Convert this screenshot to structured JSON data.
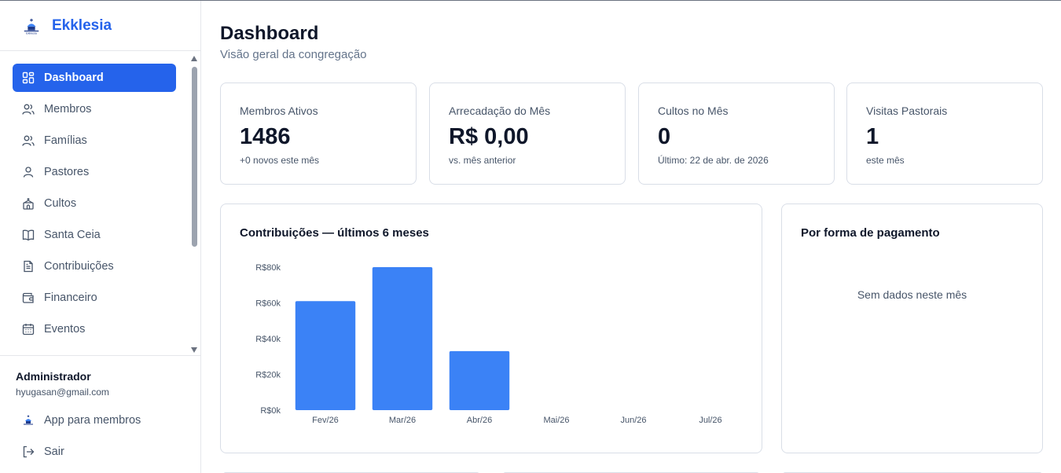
{
  "brand": {
    "name": "Ekklesia",
    "logo_text": "Ekklesia"
  },
  "sidebar": {
    "items": [
      {
        "label": "Dashboard",
        "icon": "grid-icon",
        "active": true
      },
      {
        "label": "Membros",
        "icon": "users-icon"
      },
      {
        "label": "Famílias",
        "icon": "family-icon"
      },
      {
        "label": "Pastores",
        "icon": "user-icon"
      },
      {
        "label": "Cultos",
        "icon": "church-icon"
      },
      {
        "label": "Santa Ceia",
        "icon": "book-icon"
      },
      {
        "label": "Contribuições",
        "icon": "file-text-icon"
      },
      {
        "label": "Financeiro",
        "icon": "wallet-icon"
      },
      {
        "label": "Eventos",
        "icon": "calendar-icon"
      }
    ]
  },
  "user": {
    "name": "Administrador",
    "email": "hyugasan@gmail.com",
    "app_label": "App para membros",
    "exit_label": "Sair"
  },
  "page": {
    "title": "Dashboard",
    "subtitle": "Visão geral da congregação"
  },
  "stats": [
    {
      "label": "Membros Ativos",
      "value": "1486",
      "note": "+0 novos este mês"
    },
    {
      "label": "Arrecadação do Mês",
      "value": "R$ 0,00",
      "note": "vs. mês anterior"
    },
    {
      "label": "Cultos no Mês",
      "value": "0",
      "note": "Último: 22 de abr. de 2026"
    },
    {
      "label": "Visitas Pastorais",
      "value": "1",
      "note": "este mês"
    }
  ],
  "payment_card": {
    "title": "Por forma de pagamento",
    "empty_message": "Sem dados neste mês"
  },
  "colors": {
    "accent": "#2563eb",
    "bar": "#3b82f6"
  },
  "chart_data": {
    "type": "bar",
    "title": "Contribuições — últimos 6 meses",
    "categories": [
      "Fev/26",
      "Mar/26",
      "Abr/26",
      "Mai/26",
      "Jun/26",
      "Jul/26"
    ],
    "values": [
      61000,
      80000,
      33000,
      0,
      0,
      0
    ],
    "ylim": [
      0,
      80000
    ],
    "yticks": [
      0,
      20000,
      40000,
      60000,
      80000
    ],
    "ytick_labels": [
      "R$0k",
      "R$20k",
      "R$40k",
      "R$60k",
      "R$80k"
    ],
    "xlabel": "",
    "ylabel": "",
    "grid": false,
    "legend": "none"
  }
}
